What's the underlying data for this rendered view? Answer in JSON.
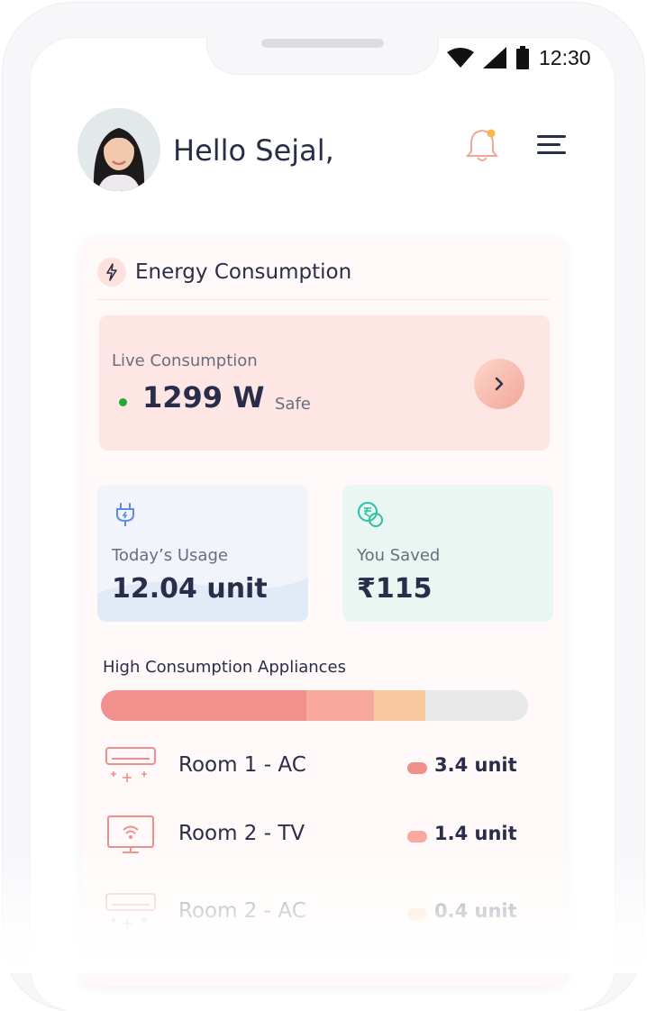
{
  "status_bar": {
    "time": "12:30"
  },
  "header": {
    "greeting": "Hello Sejal,",
    "avatar_icon": "user-avatar-photo",
    "notification_icon": "bell-icon",
    "menu_icon": "menu-icon"
  },
  "energy_card": {
    "title": "Energy Consumption",
    "title_icon": "bolt-icon",
    "live": {
      "label": "Live Consumption",
      "value": "1299 W",
      "status": "Safe",
      "status_color": "#1faa3a"
    },
    "usage": {
      "label": "Today’s Usage",
      "value": "12.04 unit",
      "icon": "plug-icon"
    },
    "saved": {
      "label": "You Saved",
      "value": "₹115",
      "icon": "rupee-coin-icon"
    },
    "high_consumption": {
      "title": "High Consumption Appliances",
      "segments": [
        {
          "fraction": 0.48,
          "color": "#f0918d"
        },
        {
          "fraction": 0.16,
          "color": "#f8a89c"
        },
        {
          "fraction": 0.12,
          "color": "#fbc99f"
        },
        {
          "fraction": 0.24,
          "color": "#e8e8e8"
        }
      ]
    },
    "appliances": [
      {
        "name": "Room 1 - AC",
        "value": "3.4 unit",
        "icon": "air-conditioner-icon",
        "color": "#ef8f8b"
      },
      {
        "name": "Room 2 - TV",
        "value": "1.4 unit",
        "icon": "tv-icon",
        "color": "#f8a89c"
      },
      {
        "name": "Room 2 - AC",
        "value": "0.4 unit",
        "icon": "air-conditioner-icon",
        "color": "#fbc99f"
      }
    ]
  }
}
